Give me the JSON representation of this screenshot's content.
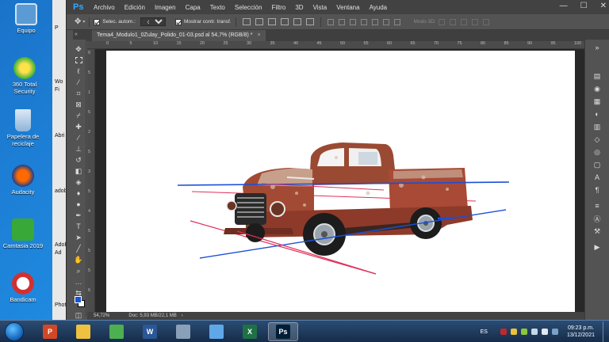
{
  "desktop": {
    "icons": [
      {
        "label": "Equipo",
        "color": "#5b9bd5"
      },
      {
        "label": "360 Total Security",
        "color": "#3ab03a"
      },
      {
        "label": "Papelera de reciclaje",
        "color": "#a8c8e8"
      },
      {
        "label": "Audacity",
        "color": "#f5a000"
      },
      {
        "label": "Camtasia 2019",
        "color": "#38a838"
      },
      {
        "label": "Bandicam",
        "color": "#d23030"
      }
    ],
    "partial_labels": [
      "P",
      "Wo",
      "Fi",
      "Abri",
      "adob",
      "Adob",
      "Ad",
      "Phot"
    ]
  },
  "photoshop": {
    "logo": "Ps",
    "menu": [
      "Archivo",
      "Edición",
      "Imagen",
      "Capa",
      "Texto",
      "Selección",
      "Filtro",
      "3D",
      "Vista",
      "Ventana",
      "Ayuda"
    ],
    "window_controls": {
      "minimize": "—",
      "maximize": "☐",
      "close": "✕"
    },
    "options": {
      "auto_select_label": "Selec. autom.:",
      "auto_select_value": "Capa",
      "transform_label": "Mostrar contr. transf.",
      "mode3d": "Modo 3D:"
    },
    "tab": {
      "title": "Tema4_Modulo1_0Zulay_Polido_01-03.psd al 54,7% (RGB/8) *",
      "close": "×"
    },
    "ruler_top": [
      "0",
      "5",
      "10",
      "15",
      "20",
      "25",
      "30",
      "35",
      "40",
      "45",
      "50",
      "55",
      "60",
      "65",
      "70",
      "75",
      "80",
      "85",
      "90",
      "95",
      "100"
    ],
    "ruler_left": [
      "0",
      "5",
      "1",
      "5",
      "2",
      "5",
      "3",
      "5",
      "4",
      "5",
      "5",
      "5",
      "6"
    ],
    "status": {
      "zoom": "54,72%",
      "doc": "Doc: 5,93 MB/22,1 MB"
    },
    "colors": {
      "foreground": "#1556d6",
      "background": "#ffffff"
    }
  },
  "perspective_lines": {
    "blue": "#1a4fd6",
    "red": "#e0305a"
  },
  "taskbar": {
    "apps": [
      {
        "name": "PowerPoint",
        "letter": "P",
        "color": "#d24726",
        "active": false
      },
      {
        "name": "Explorador",
        "letter": "",
        "color": "#f0c040",
        "active": false
      },
      {
        "name": "Chrome",
        "letter": "",
        "color": "#4caf50",
        "active": false
      },
      {
        "name": "Word",
        "letter": "W",
        "color": "#2b5797",
        "active": false
      },
      {
        "name": "Calculadora",
        "letter": "",
        "color": "#8aa0b8",
        "active": false
      },
      {
        "name": "Notas",
        "letter": "",
        "color": "#5fa8e8",
        "active": false
      },
      {
        "name": "Excel",
        "letter": "X",
        "color": "#1e7145",
        "active": false
      },
      {
        "name": "Photoshop",
        "letter": "Ps",
        "color": "#001e36",
        "active": true
      }
    ],
    "lang": "ES",
    "time": "09:23 p.m.",
    "date": "13/12/2021"
  }
}
